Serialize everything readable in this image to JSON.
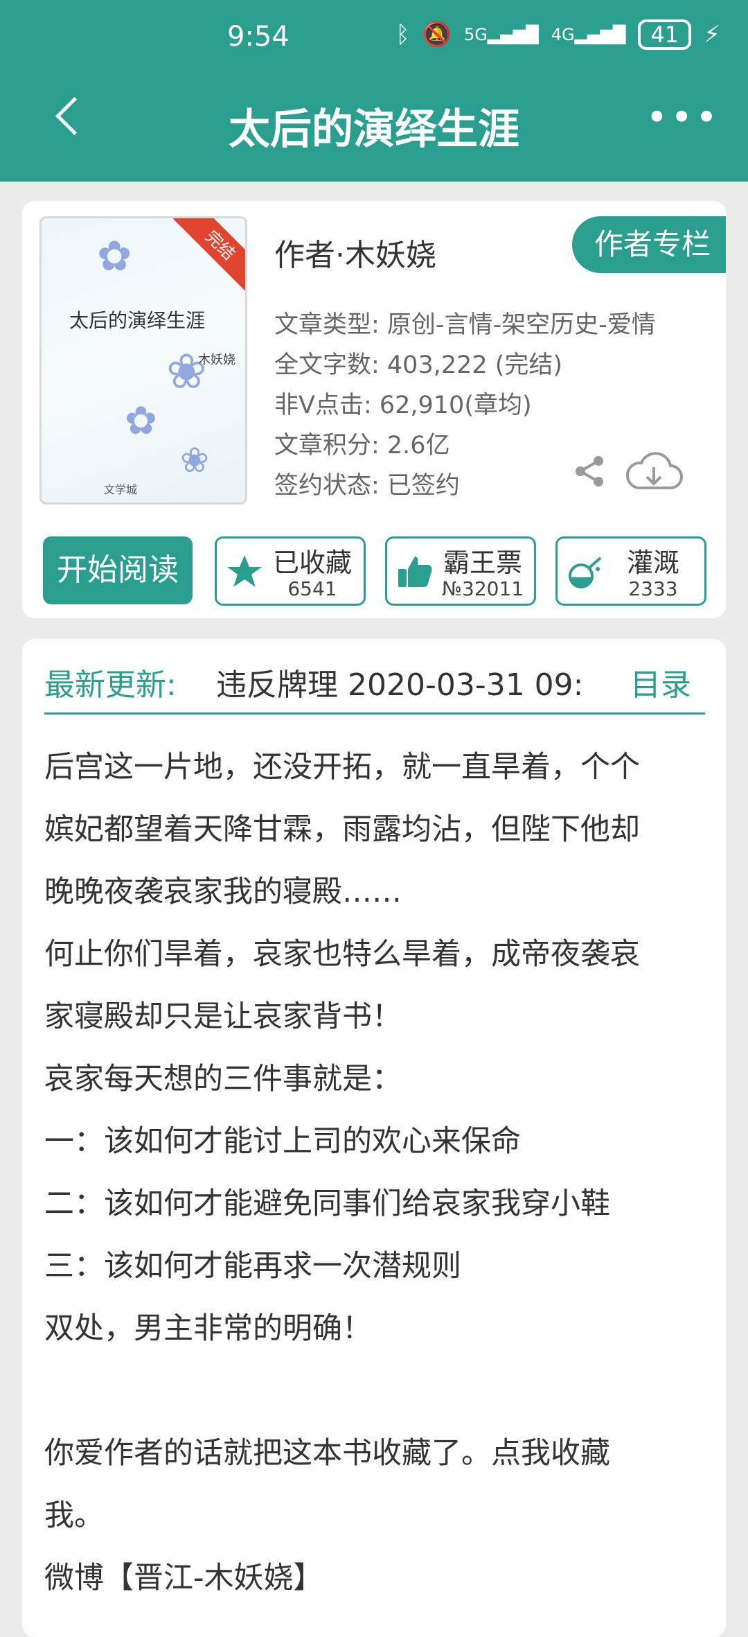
{
  "status_bar": {
    "time": "9:54",
    "icons": [
      "bluetooth-icon",
      "mute-icon",
      "5g-signal-icon",
      "4g-signal-icon"
    ],
    "battery": "41"
  },
  "header": {
    "title": "太后的演绎生涯",
    "back_icon": "back-arrow-icon",
    "more_icon": "more-icon",
    "color": "#2a9f8f"
  },
  "book": {
    "cover_title": "太后的演绎生涯",
    "cover_author": "木妖娆",
    "cover_badge": "完结",
    "cover_publisher": "文学城",
    "author_line": "作者·木妖娆",
    "author_column_button": "作者专栏",
    "info": [
      "文章类型: 原创-言情-架空历史-爱情",
      "全文字数: 403,222 (完结)",
      "非V点击: 62,910(章均)",
      "文章积分: 2.6亿",
      "签约状态: 已签约"
    ]
  },
  "actions": {
    "read": "开始阅读",
    "favorite": {
      "label": "已收藏",
      "count": "6541"
    },
    "vote": {
      "label": "霸王票",
      "count": "№32011"
    },
    "water": {
      "label": "灌溉",
      "count": "2333"
    }
  },
  "latest": {
    "label": "最新更新:",
    "value": "违反牌理  2020-03-31 09:",
    "catalog": "目录"
  },
  "summary": [
    "后宫这一片地，还没开拓，就一直旱着，个个",
    "嫔妃都望着天降甘霖，雨露均沾，但陛下他却",
    "晚晚夜袭哀家我的寝殿……",
    "何止你们旱着，哀家也特么旱着，成帝夜袭哀",
    "家寝殿却只是让哀家背书！",
    "哀家每天想的三件事就是：",
    "一：该如何才能讨上司的欢心来保命",
    "二：该如何才能避免同事们给哀家我穿小鞋",
    "三：该如何才能再求一次潜规则",
    "双处，男主非常的明确！",
    "",
    "你爱作者的话就把这本书收藏了。点我收藏",
    "我。",
    "微博【晋江-木妖娆】"
  ]
}
